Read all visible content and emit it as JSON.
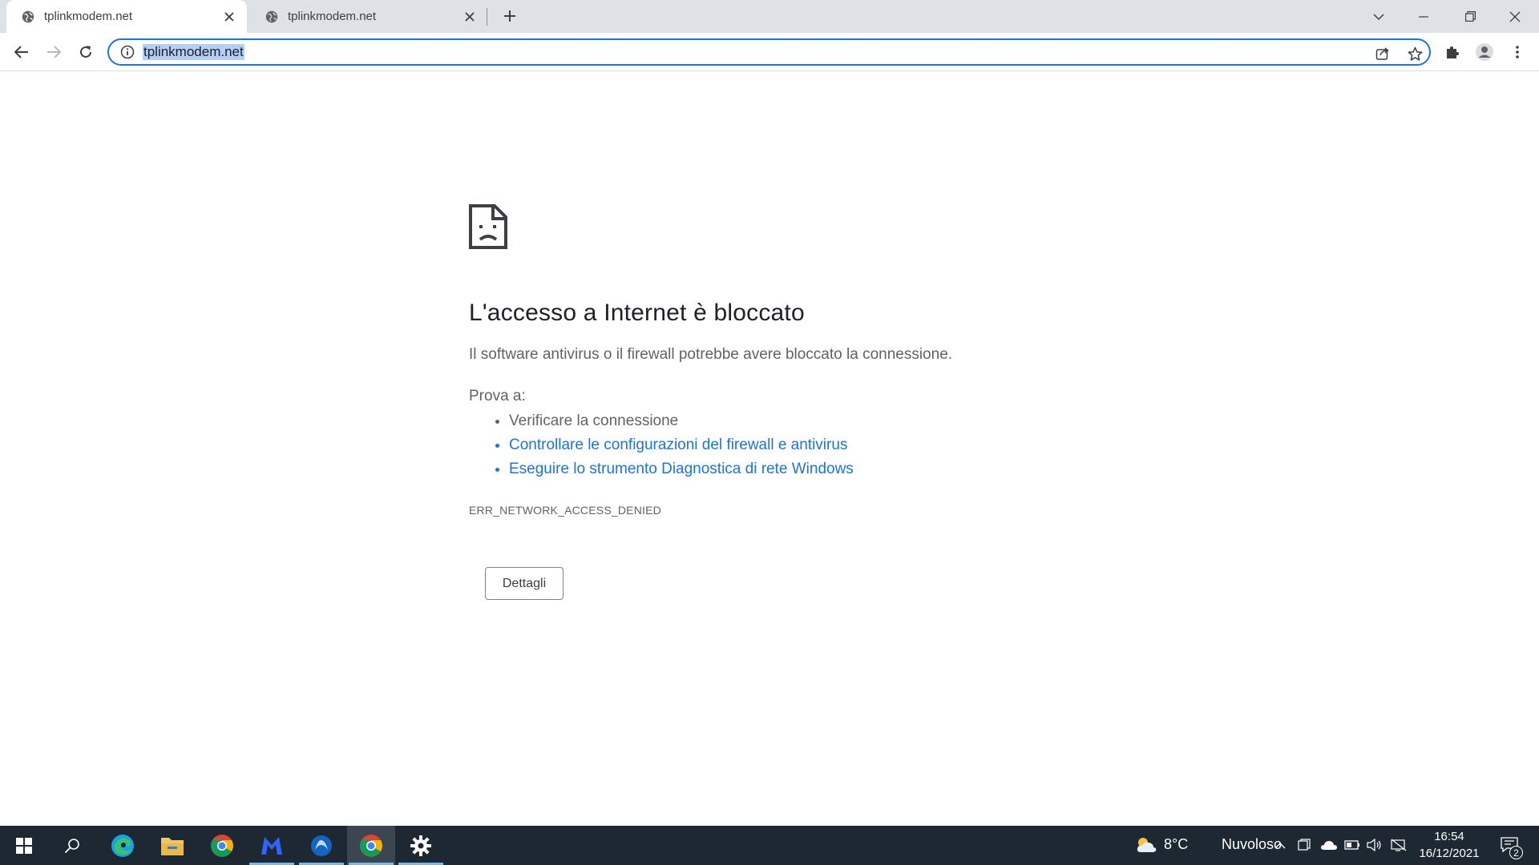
{
  "browser": {
    "tabs": [
      {
        "title": "tplinkmodem.net",
        "active": true
      },
      {
        "title": "tplinkmodem.net",
        "active": false
      }
    ],
    "address": "tplinkmodem.net"
  },
  "error_page": {
    "heading": "L'accesso a Internet è bloccato",
    "description": "Il software antivirus o il firewall potrebbe avere bloccato la connessione.",
    "try_label": "Prova a:",
    "suggestions": [
      {
        "text": "Verificare la connessione",
        "link": false
      },
      {
        "text": "Controllare le configurazioni del firewall e antivirus",
        "link": true
      },
      {
        "text": "Eseguire lo strumento Diagnostica di rete Windows",
        "link": true
      }
    ],
    "error_code": "ERR_NETWORK_ACCESS_DENIED",
    "details_button": "Dettagli"
  },
  "taskbar": {
    "apps": [
      "start-icon",
      "search-icon",
      "edge-icon",
      "file-explorer-icon",
      "chrome-icon",
      "malwarebytes-icon",
      "app-icon",
      "chrome-icon",
      "settings-icon"
    ],
    "weather": {
      "temp": "8°C",
      "condition": "Nuvoloso"
    },
    "clock": {
      "time": "16:54",
      "date": "16/12/2021"
    },
    "notification_count": "2"
  },
  "colors": {
    "link": "#1a73e8",
    "taskbar": "#1d2833",
    "tabstrip": "#dee1e6",
    "selection": "#b3cef7"
  }
}
